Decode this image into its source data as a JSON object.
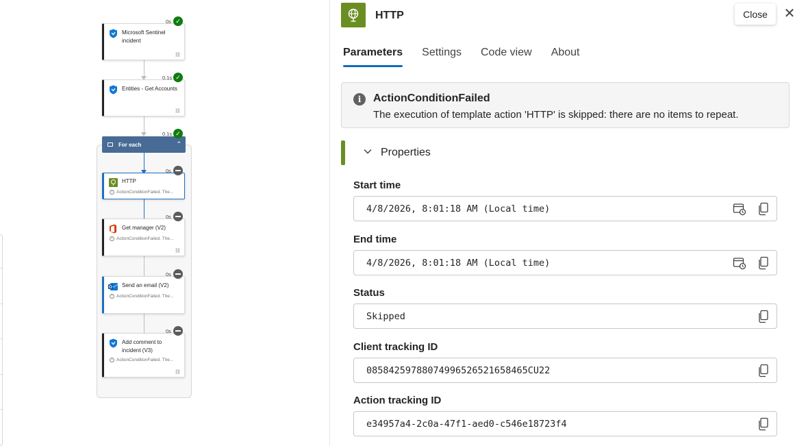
{
  "canvas": {
    "nodes": [
      {
        "id": "sentinel",
        "title": "Microsoft Sentinel incident",
        "duration": "0s",
        "status": "succeeded",
        "subtitle": ""
      },
      {
        "id": "entities",
        "title": "Entities - Get Accounts",
        "duration": "0.1s",
        "status": "succeeded",
        "subtitle": ""
      },
      {
        "id": "http",
        "title": "HTTP",
        "duration": "0s",
        "status": "skipped",
        "subtitle": "ActionConditionFailed. The..."
      },
      {
        "id": "manager",
        "title": "Get manager (V2)",
        "duration": "0s",
        "status": "skipped",
        "subtitle": "ActionConditionFailed. The..."
      },
      {
        "id": "email",
        "title": "Send an email (V2)",
        "duration": "0s",
        "status": "skipped",
        "subtitle": "ActionConditionFailed. The..."
      },
      {
        "id": "comment",
        "title": "Add comment to incident (V3)",
        "duration": "0s",
        "status": "skipped",
        "subtitle": "ActionConditionFailed. The..."
      }
    ],
    "foreach": {
      "title": "For each",
      "duration": "0.1s",
      "status": "succeeded"
    }
  },
  "panel": {
    "title": "HTTP",
    "close_label": "Close",
    "tabs": [
      {
        "label": "Parameters",
        "active": true
      },
      {
        "label": "Settings",
        "active": false
      },
      {
        "label": "Code view",
        "active": false
      },
      {
        "label": "About",
        "active": false
      }
    ],
    "banner": {
      "title": "ActionConditionFailed",
      "message": "The execution of template action 'HTTP' is skipped: there are no items to repeat."
    },
    "section_title": "Properties",
    "fields": [
      {
        "label": "Start time",
        "value": "4/8/2026, 8:01:18 AM (Local time)",
        "has_calendar": true
      },
      {
        "label": "End time",
        "value": "4/8/2026, 8:01:18 AM (Local time)",
        "has_calendar": true
      },
      {
        "label": "Status",
        "value": "Skipped",
        "has_calendar": false
      },
      {
        "label": "Client tracking ID",
        "value": "08584259788074996526521658465CU22",
        "has_calendar": false
      },
      {
        "label": "Action tracking ID",
        "value": "e34957a4-2c0a-47f1-aed0-c546e18723f4",
        "has_calendar": false
      }
    ]
  },
  "colors": {
    "http_green": "#6b8e23",
    "tab_underline": "#0f6cbd",
    "success_green": "#107c10",
    "skipped_gray": "#5c5c5c",
    "foreach_header": "#476b95",
    "selected_blue": "#1f6fbf"
  },
  "icons": {
    "sentinel": "shield-icon",
    "http": "globe-icon",
    "office": "office-icon",
    "outlook": "outlook-mail-icon",
    "info": "info-icon",
    "copy": "copy-icon",
    "calendar": "calendar-clock-icon",
    "link": "link-icon",
    "close": "close-icon"
  }
}
